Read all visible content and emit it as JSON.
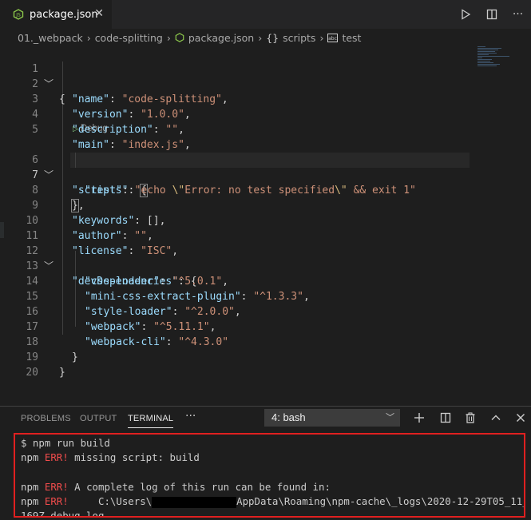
{
  "tab": {
    "filename": "package.json",
    "close": "✕"
  },
  "breadcrumb": [
    "01._webpack",
    "code-splitting",
    "package.json",
    "scripts",
    "test"
  ],
  "editor": {
    "active_line": 7,
    "line_numbers": [
      "1",
      "2",
      "3",
      "4",
      "5",
      "6",
      "7",
      "8",
      "9",
      "10",
      "11",
      "12",
      "13",
      "14",
      "15",
      "16",
      "17",
      "18",
      "19",
      "20"
    ],
    "codelens": "Debug",
    "json": {
      "name_key": "\"name\"",
      "name_val": "\"code-splitting\"",
      "version_key": "\"version\"",
      "version_val": "\"1.0.0\"",
      "description_key": "\"description\"",
      "description_val": "\"\"",
      "main_key": "\"main\"",
      "main_val": "\"index.js\"",
      "scripts_key": "\"scripts\"",
      "test_key": "\"test\"",
      "test_val_a": "\"echo ",
      "test_val_esc1": "\\\"",
      "test_val_b": "Error: no test specified",
      "test_val_esc2": "\\\"",
      "test_val_c": " && exit 1\"",
      "keywords_key": "\"keywords\"",
      "author_key": "\"author\"",
      "author_val": "\"\"",
      "license_key": "\"license\"",
      "license_val": "\"ISC\"",
      "devdeps_key": "\"devDependencies\"",
      "deps": [
        {
          "k": "\"css-loader\"",
          "v": "\"^5.0.1\""
        },
        {
          "k": "\"mini-css-extract-plugin\"",
          "v": "\"^1.3.3\""
        },
        {
          "k": "\"style-loader\"",
          "v": "\"^2.0.0\""
        },
        {
          "k": "\"webpack\"",
          "v": "\"^5.11.1\""
        },
        {
          "k": "\"webpack-cli\"",
          "v": "\"^4.3.0\""
        }
      ]
    }
  },
  "panel": {
    "tabs": [
      "PROBLEMS",
      "OUTPUT",
      "TERMINAL"
    ],
    "more": "···",
    "shell_select": "4: bash"
  },
  "terminal": {
    "l1": "$ npm run build",
    "npm": "npm",
    "err": "ERR!",
    "l2_rest": " missing script: build",
    "l4_rest": " A complete log of this run can be found in:",
    "l5_mid": "     C:\\Users\\",
    "l5_rest": "AppData\\Roaming\\npm-cache\\_logs\\2020-12-29T05_11_49_",
    "l6": "169Z-debug.log"
  }
}
